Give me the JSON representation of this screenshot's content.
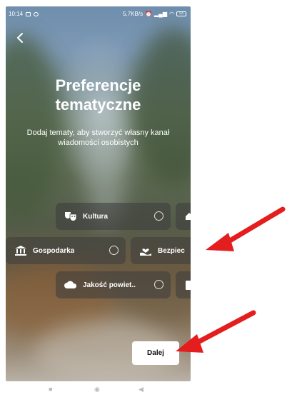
{
  "status_bar": {
    "time": "10:14",
    "network_speed": "5,7KB/s",
    "battery": "93"
  },
  "header": {
    "title_line1": "Preferencje",
    "title_line2": "tematyczne",
    "subtitle": "Dodaj tematy, aby stworzyć własny kanał wiadomości osobistych"
  },
  "topics": [
    {
      "label": "Kultura",
      "icon": "theater-masks-icon"
    },
    {
      "label": "",
      "icon": "house-icon"
    },
    {
      "label": "Gospodarka",
      "icon": "bank-building-icon"
    },
    {
      "label": "Bezpiec",
      "icon": "hand-heart-icon"
    },
    {
      "label": "Jakość powiet..",
      "icon": "cloud-icon"
    },
    {
      "label": "",
      "icon": "document-icon"
    }
  ],
  "next_button": {
    "label": "Dalej"
  },
  "colors": {
    "arrow": "#e41e1e",
    "chip_bg": "rgba(60,60,60,0.55)",
    "button_bg": "#ffffff"
  }
}
